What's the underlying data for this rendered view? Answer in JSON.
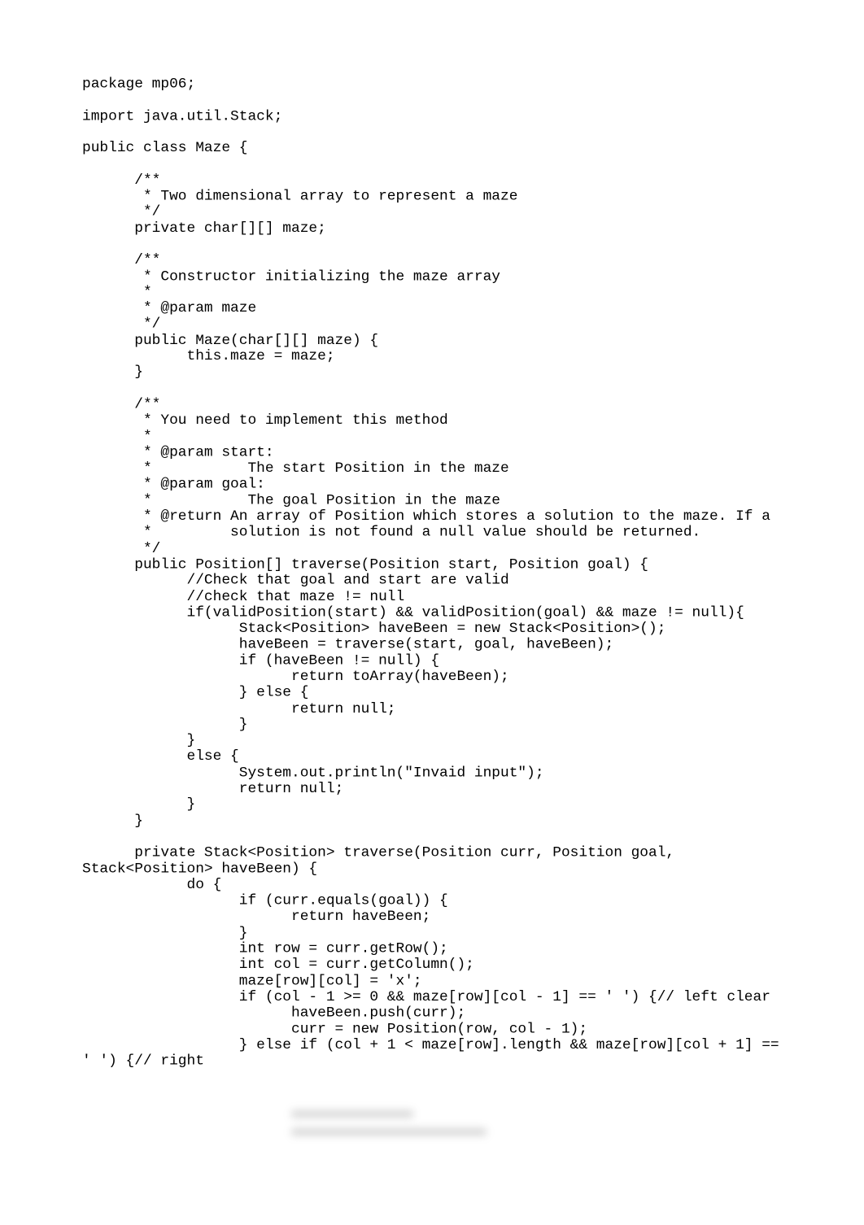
{
  "document": {
    "language": "java",
    "lines": [
      {
        "indent": 0,
        "text": "package mp06;"
      },
      {
        "indent": 0,
        "text": ""
      },
      {
        "indent": 0,
        "text": "import java.util.Stack;"
      },
      {
        "indent": 0,
        "text": ""
      },
      {
        "indent": 0,
        "text": "public class Maze {"
      },
      {
        "indent": 0,
        "text": ""
      },
      {
        "indent": 1,
        "text": "/**"
      },
      {
        "indent": 1,
        "text": " * Two dimensional array to represent a maze"
      },
      {
        "indent": 1,
        "text": " */"
      },
      {
        "indent": 1,
        "text": "private char[][] maze;"
      },
      {
        "indent": 0,
        "text": ""
      },
      {
        "indent": 1,
        "text": "/**"
      },
      {
        "indent": 1,
        "text": " * Constructor initializing the maze array"
      },
      {
        "indent": 1,
        "text": " *"
      },
      {
        "indent": 1,
        "text": " * @param maze"
      },
      {
        "indent": 1,
        "text": " */"
      },
      {
        "indent": 1,
        "text": "public Maze(char[][] maze) {"
      },
      {
        "indent": 2,
        "text": "this.maze = maze;"
      },
      {
        "indent": 1,
        "text": "}"
      },
      {
        "indent": 0,
        "text": ""
      },
      {
        "indent": 1,
        "text": "/**"
      },
      {
        "indent": 1,
        "text": " * You need to implement this method"
      },
      {
        "indent": 1,
        "text": " *"
      },
      {
        "indent": 1,
        "text": " * @param start:"
      },
      {
        "indent": 1,
        "text": " *           The start Position in the maze"
      },
      {
        "indent": 1,
        "text": " * @param goal:"
      },
      {
        "indent": 1,
        "text": " *           The goal Position in the maze"
      },
      {
        "indent": 1,
        "text": " * @return An array of Position which stores a solution to the maze. If a"
      },
      {
        "indent": 1,
        "text": " *         solution is not found a null value should be returned."
      },
      {
        "indent": 1,
        "text": " */"
      },
      {
        "indent": 1,
        "text": "public Position[] traverse(Position start, Position goal) {"
      },
      {
        "indent": 2,
        "text": "//Check that goal and start are valid"
      },
      {
        "indent": 2,
        "text": "//check that maze != null"
      },
      {
        "indent": 2,
        "text": "if(validPosition(start) && validPosition(goal) && maze != null){"
      },
      {
        "indent": 3,
        "text": "Stack<Position> haveBeen = new Stack<Position>();"
      },
      {
        "indent": 3,
        "text": "haveBeen = traverse(start, goal, haveBeen);"
      },
      {
        "indent": 3,
        "text": "if (haveBeen != null) {"
      },
      {
        "indent": 4,
        "text": "return toArray(haveBeen);"
      },
      {
        "indent": 3,
        "text": "} else {"
      },
      {
        "indent": 4,
        "text": "return null;"
      },
      {
        "indent": 3,
        "text": "}"
      },
      {
        "indent": 2,
        "text": "}"
      },
      {
        "indent": 2,
        "text": "else {"
      },
      {
        "indent": 3,
        "text": "System.out.println(\"Invaid input\");"
      },
      {
        "indent": 3,
        "text": "return null;"
      },
      {
        "indent": 2,
        "text": "}"
      },
      {
        "indent": 1,
        "text": "}"
      },
      {
        "indent": 0,
        "text": ""
      },
      {
        "indent": 1,
        "text": "private Stack<Position> traverse(Position curr, Position goal,"
      },
      {
        "indent": 0,
        "text": "Stack<Position> haveBeen) {"
      },
      {
        "indent": 2,
        "text": "do {"
      },
      {
        "indent": 3,
        "text": "if (curr.equals(goal)) {"
      },
      {
        "indent": 4,
        "text": "return haveBeen;"
      },
      {
        "indent": 3,
        "text": "}"
      },
      {
        "indent": 3,
        "text": "int row = curr.getRow();"
      },
      {
        "indent": 3,
        "text": "int col = curr.getColumn();"
      },
      {
        "indent": 3,
        "text": "maze[row][col] = 'x';"
      },
      {
        "indent": 3,
        "text": "if (col - 1 >= 0 && maze[row][col - 1] == ' ') {// left clear"
      },
      {
        "indent": 4,
        "text": "haveBeen.push(curr);"
      },
      {
        "indent": 4,
        "text": "curr = new Position(row, col - 1);"
      },
      {
        "indent": 3,
        "text": "} else if (col + 1 < maze[row].length && maze[row][col + 1] =="
      },
      {
        "indent": 0,
        "text": "' ') {// right"
      }
    ]
  },
  "colors": {
    "text": "#000000",
    "background": "#ffffff"
  }
}
